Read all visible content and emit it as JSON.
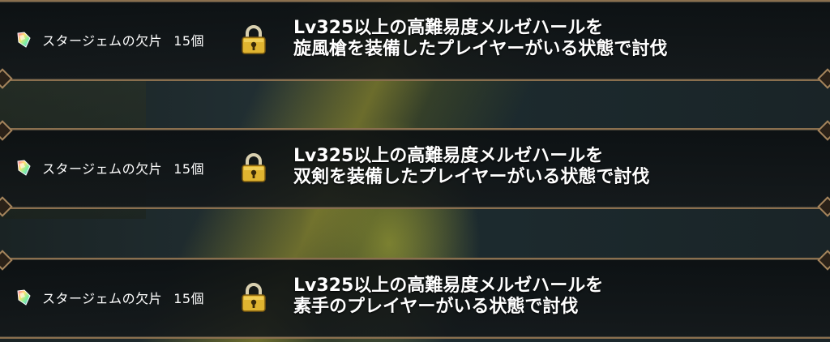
{
  "missions": [
    {
      "reward_name": "スタージェムの欠片",
      "reward_count": "15個",
      "condition_line1": "Lv325以上の高難易度メルゼハールを",
      "condition_line2": "旋風槍を装備したプレイヤーがいる状態で討伐",
      "locked": true
    },
    {
      "reward_name": "スタージェムの欠片",
      "reward_count": "15個",
      "condition_line1": "Lv325以上の高難易度メルゼハールを",
      "condition_line2": "双剣を装備したプレイヤーがいる状態で討伐",
      "locked": true
    },
    {
      "reward_name": "スタージェムの欠片",
      "reward_count": "15個",
      "condition_line1": "Lv325以上の高難易度メルゼハールを",
      "condition_line2": "素手のプレイヤーがいる状態で討伐",
      "locked": true
    }
  ],
  "icons": {
    "reward": "star-gem-fragment-icon",
    "lock": "padlock-icon"
  },
  "colors": {
    "frame_border": "#8a6f4e",
    "lock_gold": "#e0b430",
    "text": "#ffffff"
  }
}
